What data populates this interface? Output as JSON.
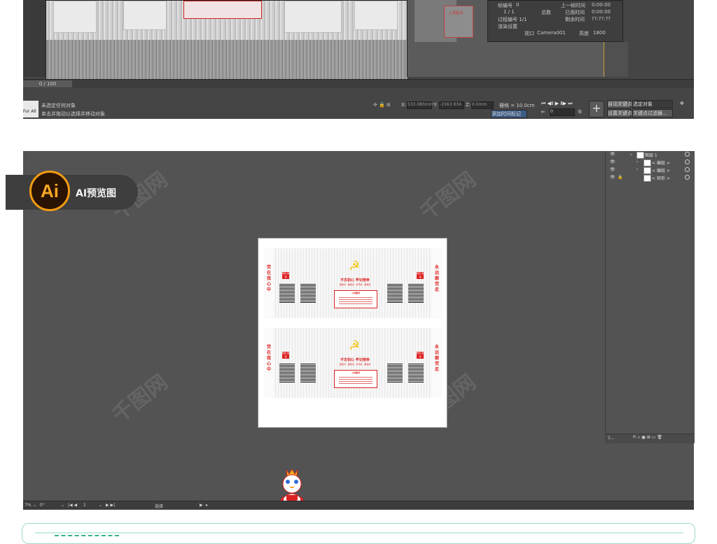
{
  "max": {
    "timeline_position": "0 / 100",
    "status_line1": "未选定任何对象",
    "status_line2": "单击并拖动以选择并移动对象",
    "thumb_text": "For All",
    "coord_x_label": "X:",
    "coord_x": "533.085mm",
    "coord_y_label": "Y:",
    "coord_y": "-1563.934",
    "coord_z_label": "Z:",
    "coord_z": "0.0mm",
    "grid_label": "栅格 = 10.0cm",
    "add_time_tag": "添加时间标记",
    "auto_key": "自动关键点",
    "selected_object": "选定对象",
    "set_key": "设置关键点",
    "key_filter": "关键点过滤器...",
    "frame_field": "0",
    "properties": {
      "frame_no_label": "帧编号",
      "frame_no_value": "0",
      "ratio_value": "1 / 1",
      "total_label": "总数",
      "prev_frame_time_label": "上一帧时间",
      "prev_frame_time": "0:00:00",
      "elapsed_label": "已用时间",
      "elapsed": "0:00:00",
      "process_no_label": "过程编号 1/1",
      "remaining_label": "剩余时间",
      "remaining": "??:??:??",
      "render_settings": "渲染设置",
      "viewport_label": "视口",
      "viewport_value": "Camera001",
      "height_label": "高度",
      "height_value": "1800"
    },
    "viewport_box_text": "入党誓词"
  },
  "ai": {
    "badge_logo": "Ai",
    "badge_label": "AI预览图",
    "layers": [
      {
        "name": "图层 1",
        "indent": 0,
        "expanded": true,
        "lock": false
      },
      {
        "name": "< 编组 >",
        "indent": 1,
        "expanded": false,
        "lock": false
      },
      {
        "name": "< 编组 >",
        "indent": 1,
        "expanded": false,
        "lock": false
      },
      {
        "name": "< 矩形 >",
        "indent": 1,
        "expanded": false,
        "lock": true
      }
    ],
    "layers_footer": "1...",
    "statusbar": {
      "zoom": "7%",
      "rotation": "0°",
      "artboard_no": "1",
      "tool": "选择"
    },
    "design": {
      "left_vertical": "党在我心中",
      "right_vertical": "永远跟党走",
      "slogan": "不忘初心 牢记使命",
      "slogan_sub": "国旗光 · 跟党走 · 好开篇 · 跟我来",
      "oath_title": "入党誓词",
      "side_label": "党员 承诺",
      "emblem": "☭"
    }
  },
  "watermark": "千图网",
  "colors": {
    "max_bg": "#454545",
    "ai_bg": "#535353",
    "ai_orange": "#f39c12",
    "party_red": "#dd2222",
    "emblem_yellow": "#f1c40f",
    "frame_green": "#37b18d"
  },
  "icons": [
    "play-icon",
    "prev-frame-icon",
    "next-frame-icon",
    "key-icon",
    "eye-icon",
    "lock-icon",
    "mascot-icon"
  ]
}
